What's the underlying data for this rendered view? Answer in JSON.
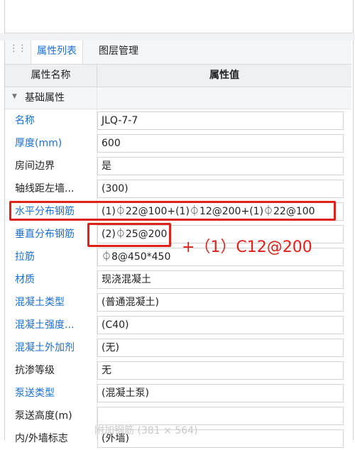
{
  "tabs": {
    "active": "属性列表",
    "inactive": "图层管理"
  },
  "header": {
    "name_col": "属性名称",
    "value_col": "属性值"
  },
  "group": {
    "label": "基础属性"
  },
  "rows": [
    {
      "name": "名称",
      "value": "JLQ-7-7",
      "color": "blue"
    },
    {
      "name": "厚度(mm)",
      "value": "600",
      "color": "blue"
    },
    {
      "name": "房间边界",
      "value": "是",
      "color": "black"
    },
    {
      "name": "轴线距左墙...",
      "value": "(300)",
      "color": "black"
    },
    {
      "name": "水平分布钢筋",
      "value": "(1)⏀22@100+(1)⏀12@200+(1)⏀22@100",
      "color": "blue"
    },
    {
      "name": "垂直分布钢筋",
      "value": "(2)⏀25@200",
      "color": "blue"
    },
    {
      "name": "拉筋",
      "value": "⏀8@450*450",
      "color": "blue"
    },
    {
      "name": "材质",
      "value": "现浇混凝土",
      "color": "blue"
    },
    {
      "name": "混凝土类型",
      "value": "(普通混凝土)",
      "color": "blue"
    },
    {
      "name": "混凝土强度...",
      "value": "(C40)",
      "color": "blue"
    },
    {
      "name": "混凝土外加剂",
      "value": "(无)",
      "color": "blue"
    },
    {
      "name": "抗渗等级",
      "value": "无",
      "color": "black"
    },
    {
      "name": "泵送类型",
      "value": "(混凝土泵)",
      "color": "blue"
    },
    {
      "name": "泵送高度(m)",
      "value": "",
      "color": "black"
    },
    {
      "name": "内/外墙标志",
      "value": "(外墙)",
      "color": "black"
    }
  ],
  "annotation": "+（1）C12@200",
  "watermark": "附加钢筋 (381 × 564)",
  "colors": {
    "accent": "#1a6fd1",
    "highlight": "#e0201b"
  }
}
